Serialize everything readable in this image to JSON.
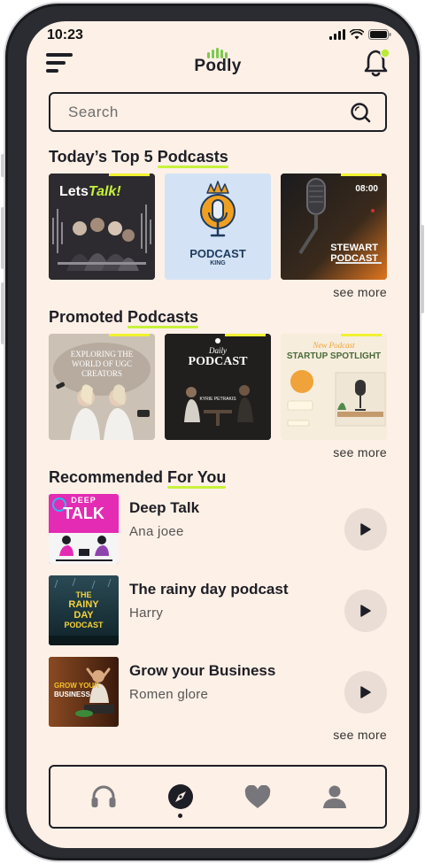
{
  "status_bar": {
    "time": "10:23"
  },
  "header": {
    "logo": "Podly"
  },
  "search": {
    "placeholder": "Search"
  },
  "sections": {
    "top5": {
      "title_part1": "Today’s Top 5 ",
      "title_part2": "Podcasts"
    },
    "promoted": {
      "title_part1": "Promoted ",
      "title_part2": "Podcasts"
    },
    "recommended": {
      "title_part1": "Recommended ",
      "title_part2": "For You"
    }
  },
  "top5_cards": [
    {
      "art_line1": "Lets",
      "art_line2": "Talk!"
    },
    {
      "art_line1": "PODCAST",
      "art_line2": "KING"
    },
    {
      "art_line1": "STEWART",
      "art_line2": "PODCAST",
      "art_time": "08:00"
    }
  ],
  "promoted_cards": [
    {
      "art_line1": "EXPLORING THE",
      "art_line2": "WORLD OF UGC",
      "art_line3": "CREATORS"
    },
    {
      "art_line1": "Daily",
      "art_line2": "PODCAST",
      "art_line3": "KYRIE PETRAKIS"
    },
    {
      "art_line1": "New Podcast",
      "art_line2": "STARTUP SPOTLIGHT"
    }
  ],
  "see_more_label": "see more",
  "recommended": [
    {
      "title": "Deep Talk",
      "author": "Ana joee",
      "art_line1": "DEEP",
      "art_line2": "TALK"
    },
    {
      "title": "The rainy day podcast",
      "author": "Harry",
      "art_line1": "THE",
      "art_line2": "RAINY",
      "art_line3": "DAY",
      "art_line4": "PODCAST"
    },
    {
      "title": "Grow your Business",
      "author": "Romen glore",
      "art_line1": "GROW YOUR",
      "art_line2": "BUSINESS"
    }
  ],
  "bottom_nav": [
    "headphones-icon",
    "compass-icon",
    "heart-icon",
    "profile-icon"
  ],
  "colors": {
    "background": "#fdf0e6",
    "accent": "#c7f23c",
    "ink": "#1e1e26",
    "play_button": "#e9ddd5"
  }
}
